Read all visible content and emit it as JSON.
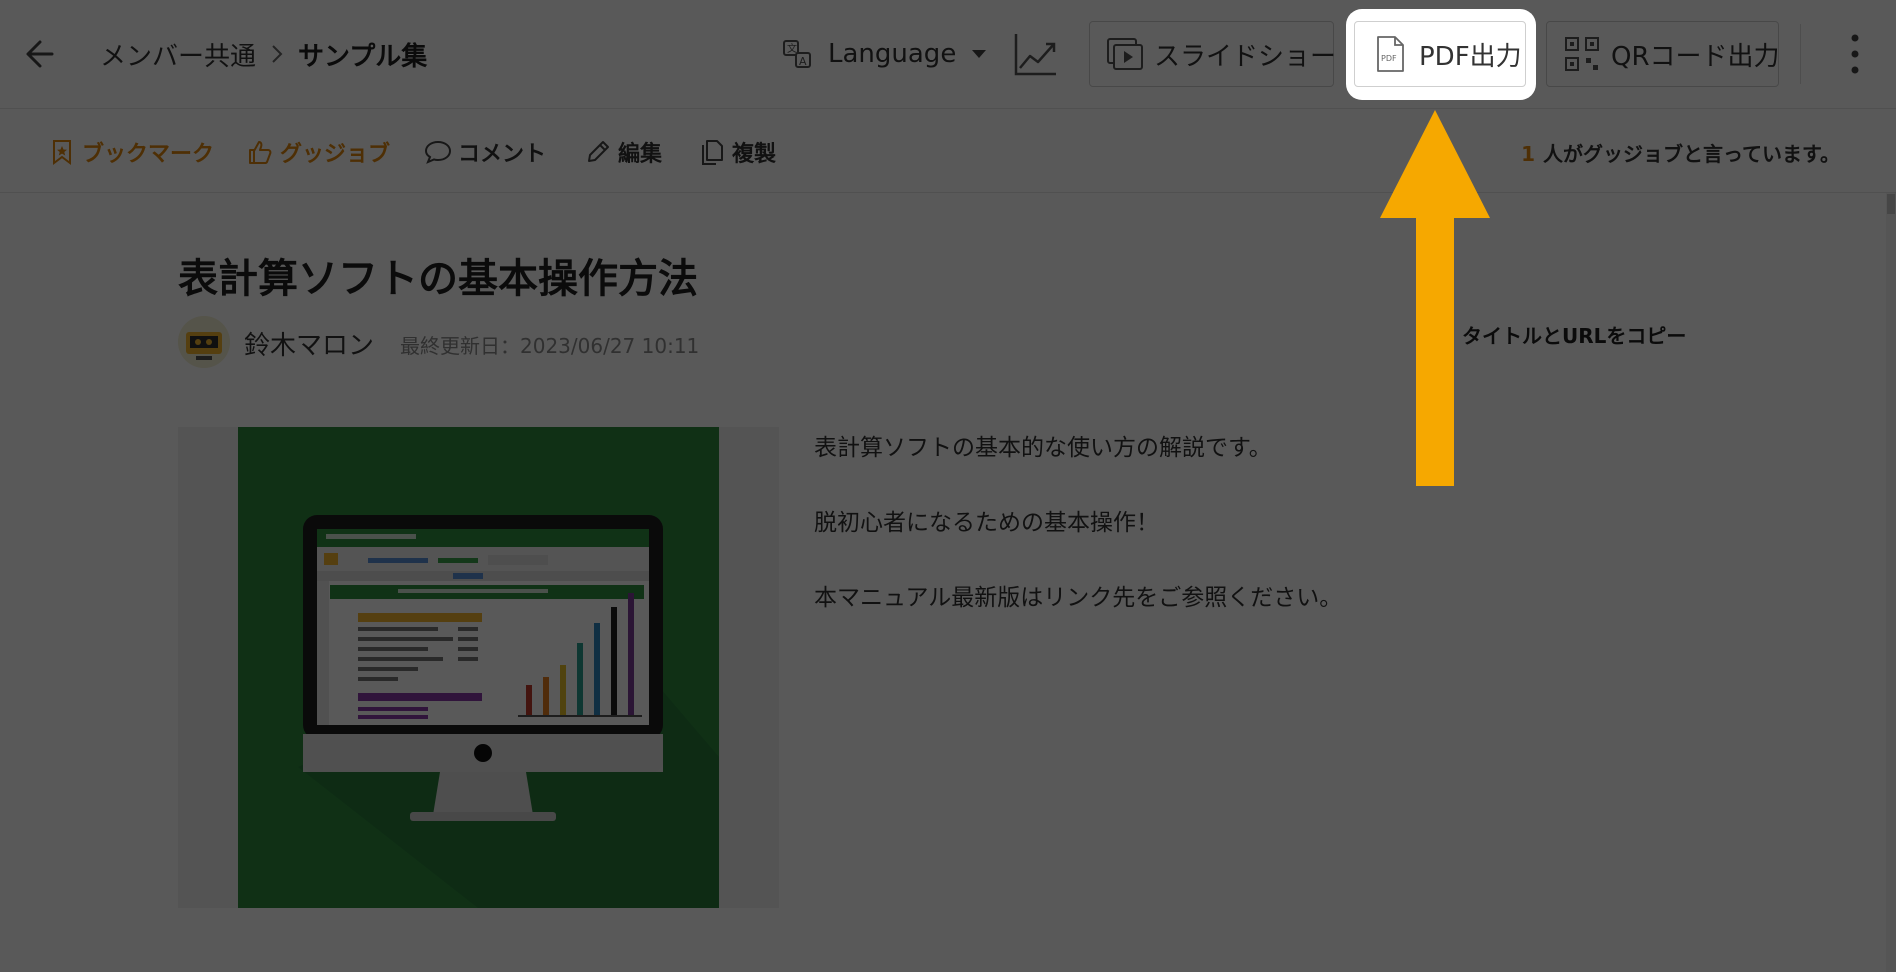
{
  "colors": {
    "accent_orange": "#E0870F",
    "arrow": "#F6A800",
    "overlay": "rgba(0,0,0,0.65)",
    "thumbnail_green": "#2E8B3E"
  },
  "header": {
    "back_icon": "arrow-left-icon",
    "breadcrumb": {
      "parent": "メンバー共通",
      "current": "サンプル集"
    },
    "language": {
      "label": "Language",
      "icon": "translate-icon"
    },
    "analytics_icon": "line-chart-icon",
    "buttons": {
      "slideshow": "スライドショー",
      "pdf": "PDF出力",
      "qr": "QRコード出力"
    },
    "more_icon": "vertical-ellipsis-icon"
  },
  "actionbar": {
    "bookmark": "ブックマーク",
    "goodjob": "グッジョブ",
    "comment": "コメント",
    "edit": "編集",
    "copy": "複製",
    "goodjob_count": "1",
    "goodjob_text": "人がグッジョブと言っています。"
  },
  "article": {
    "title": "表計算ソフトの基本操作方法",
    "author": "鈴木マロン",
    "updated": "最終更新日：2023/06/27 10:11",
    "description": [
      "表計算ソフトの基本的な使い方の解説です。",
      "脱初心者になるための基本操作！",
      "本マニュアル最新版はリンク先をご参照ください。"
    ],
    "copy_link": "タイトルとURLをコピー"
  }
}
